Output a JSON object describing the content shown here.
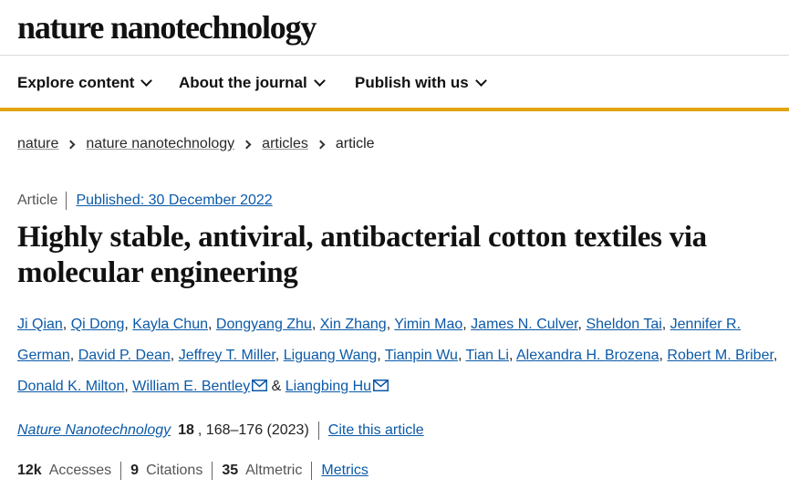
{
  "site": {
    "logo": "nature nanotechnology"
  },
  "nav": {
    "items": [
      "Explore content",
      "About the journal",
      "Publish with us"
    ]
  },
  "breadcrumb": [
    "nature",
    "nature nanotechnology",
    "articles",
    "article"
  ],
  "article": {
    "type": "Article",
    "published": "Published: 30 December 2022",
    "title": "Highly stable, antiviral, antibacterial cotton textiles via molecular engineering",
    "authors": [
      "Ji Qian",
      "Qi Dong",
      "Kayla Chun",
      "Dongyang Zhu",
      "Xin Zhang",
      "Yimin Mao",
      "James N. Culver",
      "Sheldon Tai",
      "Jennifer R. German",
      "David P. Dean",
      "Jeffrey T. Miller",
      "Liguang Wang",
      "Tianpin Wu",
      "Tian Li",
      "Alexandra H. Brozena",
      "Robert M. Briber",
      "Donald K. Milton",
      "William E. Bentley",
      "Liangbing Hu"
    ],
    "amp": "&",
    "journal_name": "Nature Nanotechnology",
    "volume": "18",
    "pages": ", 168–176 (2023)",
    "cite_label": "Cite this article"
  },
  "metrics": {
    "accesses_value": "12k",
    "accesses_label": "Accesses",
    "citations_value": "9",
    "citations_label": "Citations",
    "altmetric_value": "35",
    "altmetric_label": "Altmetric",
    "metrics_link": "Metrics"
  },
  "colors": {
    "link": "#0c5aa8",
    "accent_bar": "#e3a413"
  },
  "icons": {
    "envelope": "envelope-icon",
    "chevron": "chevron-down-icon",
    "breadcrumb_sep": "chevron-right-icon"
  }
}
